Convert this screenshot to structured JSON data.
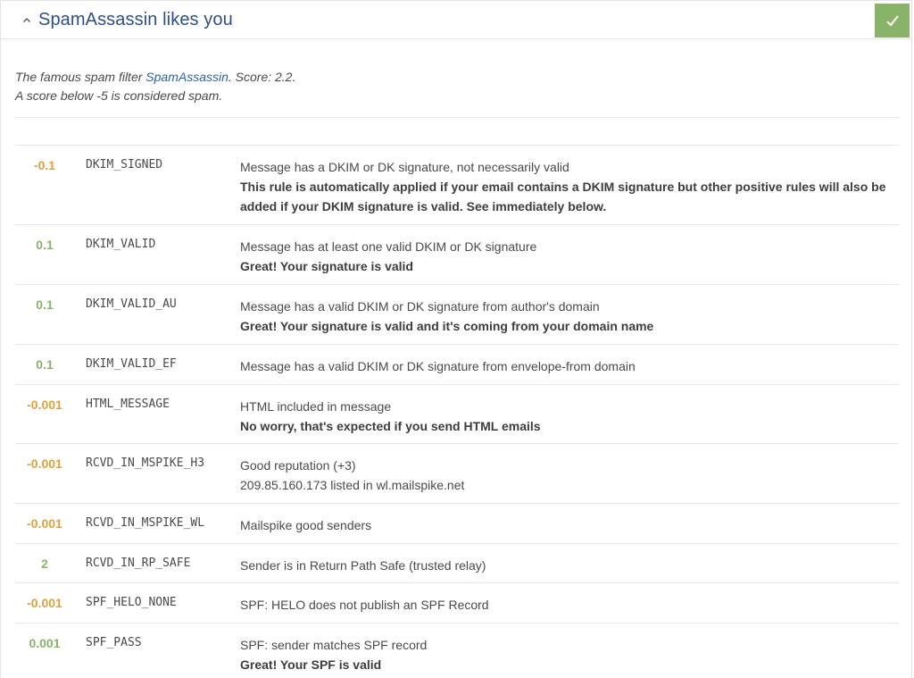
{
  "header": {
    "title": "SpamAssassin likes you",
    "collapse_icon": "chevron-up-icon",
    "status_icon": "checkmark-icon",
    "status_color": "#8ab36a"
  },
  "intro": {
    "line1_prefix": "The famous spam filter ",
    "link_text": "SpamAssassin",
    "line1_suffix": ". Score: 2.2.",
    "line2": "A score below -5 is considered spam."
  },
  "colors": {
    "negative_score": "#e0a03c",
    "positive_score": "#8ab36a",
    "title": "#2d4f86"
  },
  "rules": [
    {
      "score": "-0.1",
      "sign": "neg",
      "name": "DKIM_SIGNED",
      "description": "Message has a DKIM or DK signature, not necessarily valid",
      "note": "This rule is automatically applied if your email contains a DKIM signature but other positive rules will also be added if your DKIM signature is valid. See immediately below."
    },
    {
      "score": "0.1",
      "sign": "pos",
      "name": "DKIM_VALID",
      "description": "Message has at least one valid DKIM or DK signature",
      "note": "Great! Your signature is valid"
    },
    {
      "score": "0.1",
      "sign": "pos",
      "name": "DKIM_VALID_AU",
      "description": "Message has a valid DKIM or DK signature from author's domain",
      "note": "Great! Your signature is valid and it's coming from your domain name"
    },
    {
      "score": "0.1",
      "sign": "pos",
      "name": "DKIM_VALID_EF",
      "description": "Message has a valid DKIM or DK signature from envelope-from domain",
      "note": ""
    },
    {
      "score": "-0.001",
      "sign": "neg",
      "name": "HTML_MESSAGE",
      "description": "HTML included in message",
      "note": "No worry, that's expected if you send HTML emails"
    },
    {
      "score": "-0.001",
      "sign": "neg",
      "name": "RCVD_IN_MSPIKE_H3",
      "description": "Good reputation (+3)",
      "detail": "209.85.160.173 listed in wl.mailspike.net",
      "note": ""
    },
    {
      "score": "-0.001",
      "sign": "neg",
      "name": "RCVD_IN_MSPIKE_WL",
      "description": "Mailspike good senders",
      "note": ""
    },
    {
      "score": "2",
      "sign": "pos",
      "name": "RCVD_IN_RP_SAFE",
      "description": "Sender is in Return Path Safe (trusted relay)",
      "note": ""
    },
    {
      "score": "-0.001",
      "sign": "neg",
      "name": "SPF_HELO_NONE",
      "description": "SPF: HELO does not publish an SPF Record",
      "note": ""
    },
    {
      "score": "0.001",
      "sign": "pos",
      "name": "SPF_PASS",
      "description": "SPF: sender matches SPF record",
      "note": "Great! Your SPF is valid"
    }
  ]
}
